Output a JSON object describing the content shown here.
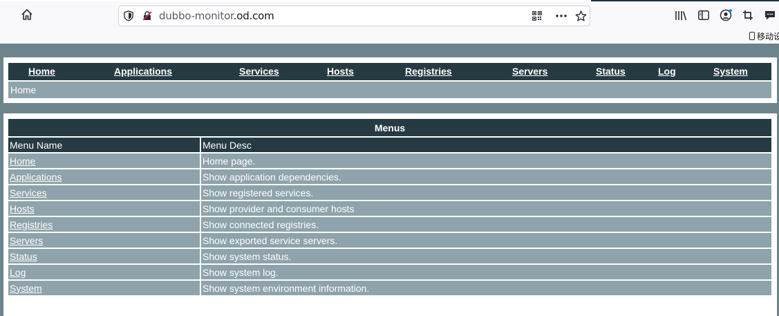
{
  "browser": {
    "url_prefix": "dubbo-monitor",
    "url_domain": ".od.com",
    "phone_hint": "移动设"
  },
  "nav": {
    "items": [
      {
        "label": "Home"
      },
      {
        "label": "Applications"
      },
      {
        "label": "Services"
      },
      {
        "label": "Hosts"
      },
      {
        "label": "Registries"
      },
      {
        "label": "Servers"
      },
      {
        "label": "Status"
      },
      {
        "label": "Log"
      },
      {
        "label": "System"
      }
    ],
    "breadcrumb": "Home"
  },
  "menus": {
    "title": "Menus",
    "col_name": "Menu Name",
    "col_desc": "Menu Desc",
    "rows": [
      {
        "name": "Home",
        "desc": "Home page."
      },
      {
        "name": "Applications",
        "desc": "Show application dependencies."
      },
      {
        "name": "Services",
        "desc": "Show registered services."
      },
      {
        "name": "Hosts",
        "desc": "Show provider and consumer hosts"
      },
      {
        "name": "Registries",
        "desc": "Show connected registries."
      },
      {
        "name": "Servers",
        "desc": "Show exported service servers."
      },
      {
        "name": "Status",
        "desc": "Show system status."
      },
      {
        "name": "Log",
        "desc": "Show system log."
      },
      {
        "name": "System",
        "desc": "Show system environment information."
      }
    ]
  }
}
